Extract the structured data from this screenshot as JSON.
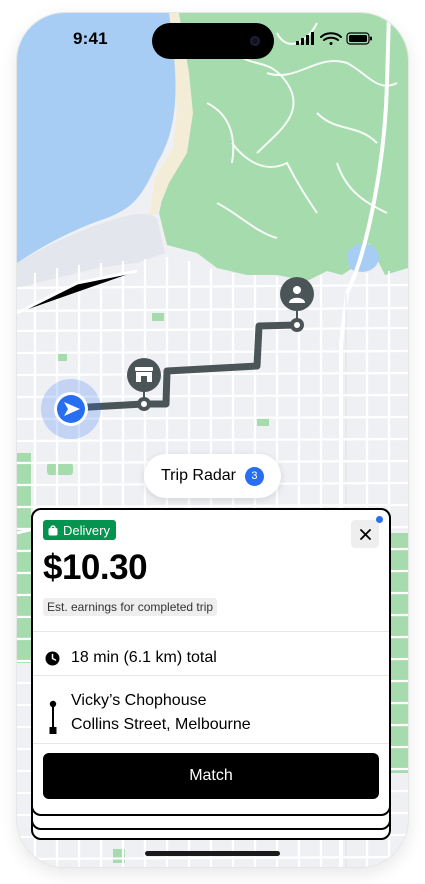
{
  "status_bar": {
    "time": "9:41"
  },
  "map": {
    "water_color": "#a8cdf5",
    "park_color": "#a6dbad",
    "route_color": "#4b5558",
    "current_location_color": "#276ef1",
    "icons": [
      "navigation-arrow-icon",
      "store-icon",
      "person-icon"
    ]
  },
  "trip_radar": {
    "label": "Trip Radar",
    "count": "3"
  },
  "offer_card": {
    "badge_label": "Delivery",
    "badge_color": "#05944f",
    "fare": "$10.30",
    "earnings_note": "Est. earnings for completed trip",
    "duration": "18 min (6.1 km) total",
    "pickup": "Vicky’s Chophouse",
    "dropoff": "Collins Street, Melbourne",
    "match_label": "Match",
    "notification_dot_color": "#276ef1"
  }
}
